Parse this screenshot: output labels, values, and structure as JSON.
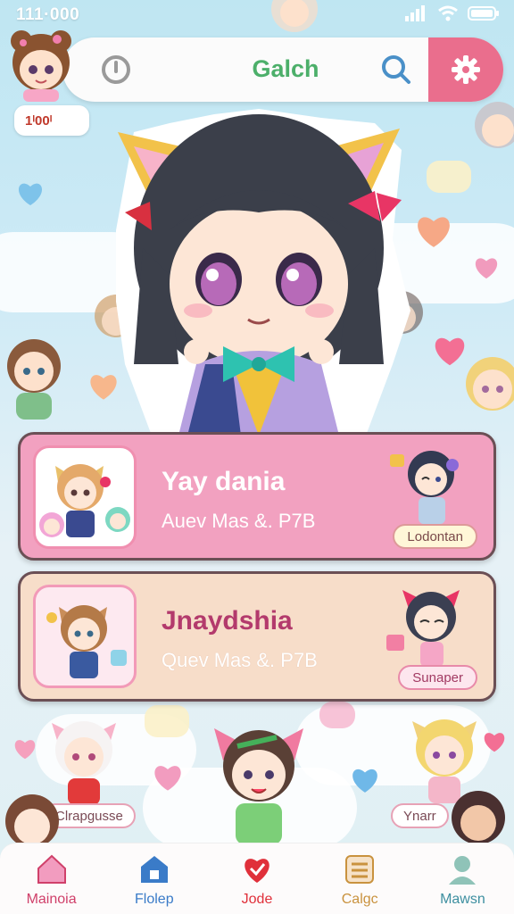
{
  "status_bar": {
    "time": "111·000"
  },
  "search": {
    "title": "Galch"
  },
  "profile": {
    "badge": "1ᴵ00ᴵ"
  },
  "cards": [
    {
      "name": "Yay dania",
      "subtitle": "Auev Mas &. P7B",
      "tag": "Lodontan"
    },
    {
      "name": "Jnaydshia",
      "subtitle": "Quev Mas &. P7B",
      "tag": "Sunaper"
    }
  ],
  "bottom_labels": {
    "left": "Clrapgusse",
    "right": "Ynarr"
  },
  "tabs": [
    {
      "label": "Mainoia",
      "icon": "home-icon",
      "color": "#d0406a"
    },
    {
      "label": "Flolep",
      "icon": "house-icon",
      "color": "#3a7bc8"
    },
    {
      "label": "Jode",
      "icon": "heart-icon",
      "color": "#e0303a"
    },
    {
      "label": "Calgc",
      "icon": "list-icon",
      "color": "#c9923e"
    },
    {
      "label": "Mawsn",
      "icon": "profile-icon",
      "color": "#3d8fa0"
    }
  ],
  "colors": {
    "accent_pink": "#ea6e8d",
    "title_green": "#4caf6a"
  }
}
